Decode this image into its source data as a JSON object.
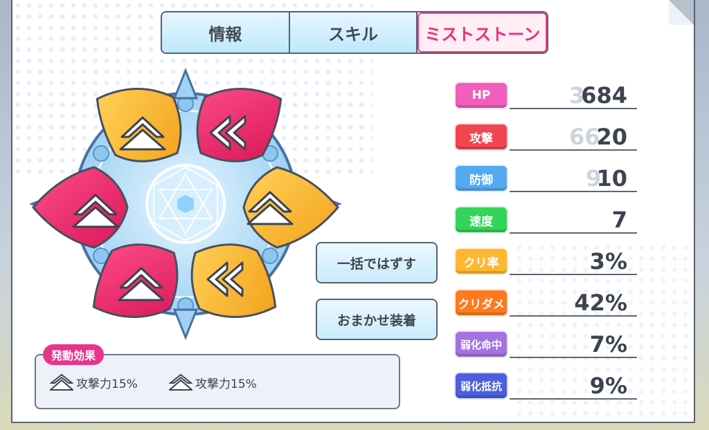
{
  "tabs": [
    {
      "label": "情報",
      "active": false
    },
    {
      "label": "スキル",
      "active": false
    },
    {
      "label": "ミストストーン",
      "active": true
    }
  ],
  "buttons": {
    "unequip_all": "一括ではずす",
    "auto_equip": "おまかせ装着"
  },
  "effect": {
    "title": "発動効果",
    "items": [
      {
        "icon": "double-chevron-up-icon",
        "text": "攻撃力15%"
      },
      {
        "icon": "double-chevron-up-icon",
        "text": "攻撃力15%"
      }
    ]
  },
  "stats": [
    {
      "label": "HP",
      "value": "684",
      "ghost": "3",
      "color": "#f05fb9"
    },
    {
      "label": "攻撃",
      "value": "20",
      "ghost": "66",
      "color": "#ef4650"
    },
    {
      "label": "防御",
      "value": "10",
      "ghost": "9",
      "color": "#55a8f2"
    },
    {
      "label": "速度",
      "value": "7",
      "ghost": "",
      "color": "#35d35a"
    },
    {
      "label": "クリ率",
      "value": "3%",
      "ghost": "",
      "color": "#ffb732"
    },
    {
      "label": "クリダメ",
      "value": "42%",
      "ghost": "",
      "color": "#ff7a1e"
    },
    {
      "label": "弱化命中",
      "value": "7%",
      "ghost": "",
      "color": "#a374e0"
    },
    {
      "label": "弱化抵抗",
      "value": "9%",
      "ghost": "",
      "color": "#4c5fdc"
    }
  ],
  "stones": [
    {
      "slot": "top-left",
      "color": "orange",
      "icon": "double-chevron-up-icon"
    },
    {
      "slot": "top-right",
      "color": "red",
      "icon": "double-chevron-left-icon"
    },
    {
      "slot": "right",
      "color": "orange",
      "icon": "double-chevron-up-icon"
    },
    {
      "slot": "bottom-right",
      "color": "orange",
      "icon": "double-chevron-left-icon"
    },
    {
      "slot": "bottom-left",
      "color": "red",
      "icon": "double-chevron-up-icon"
    },
    {
      "slot": "left",
      "color": "red",
      "icon": "double-chevron-up-icon"
    }
  ]
}
